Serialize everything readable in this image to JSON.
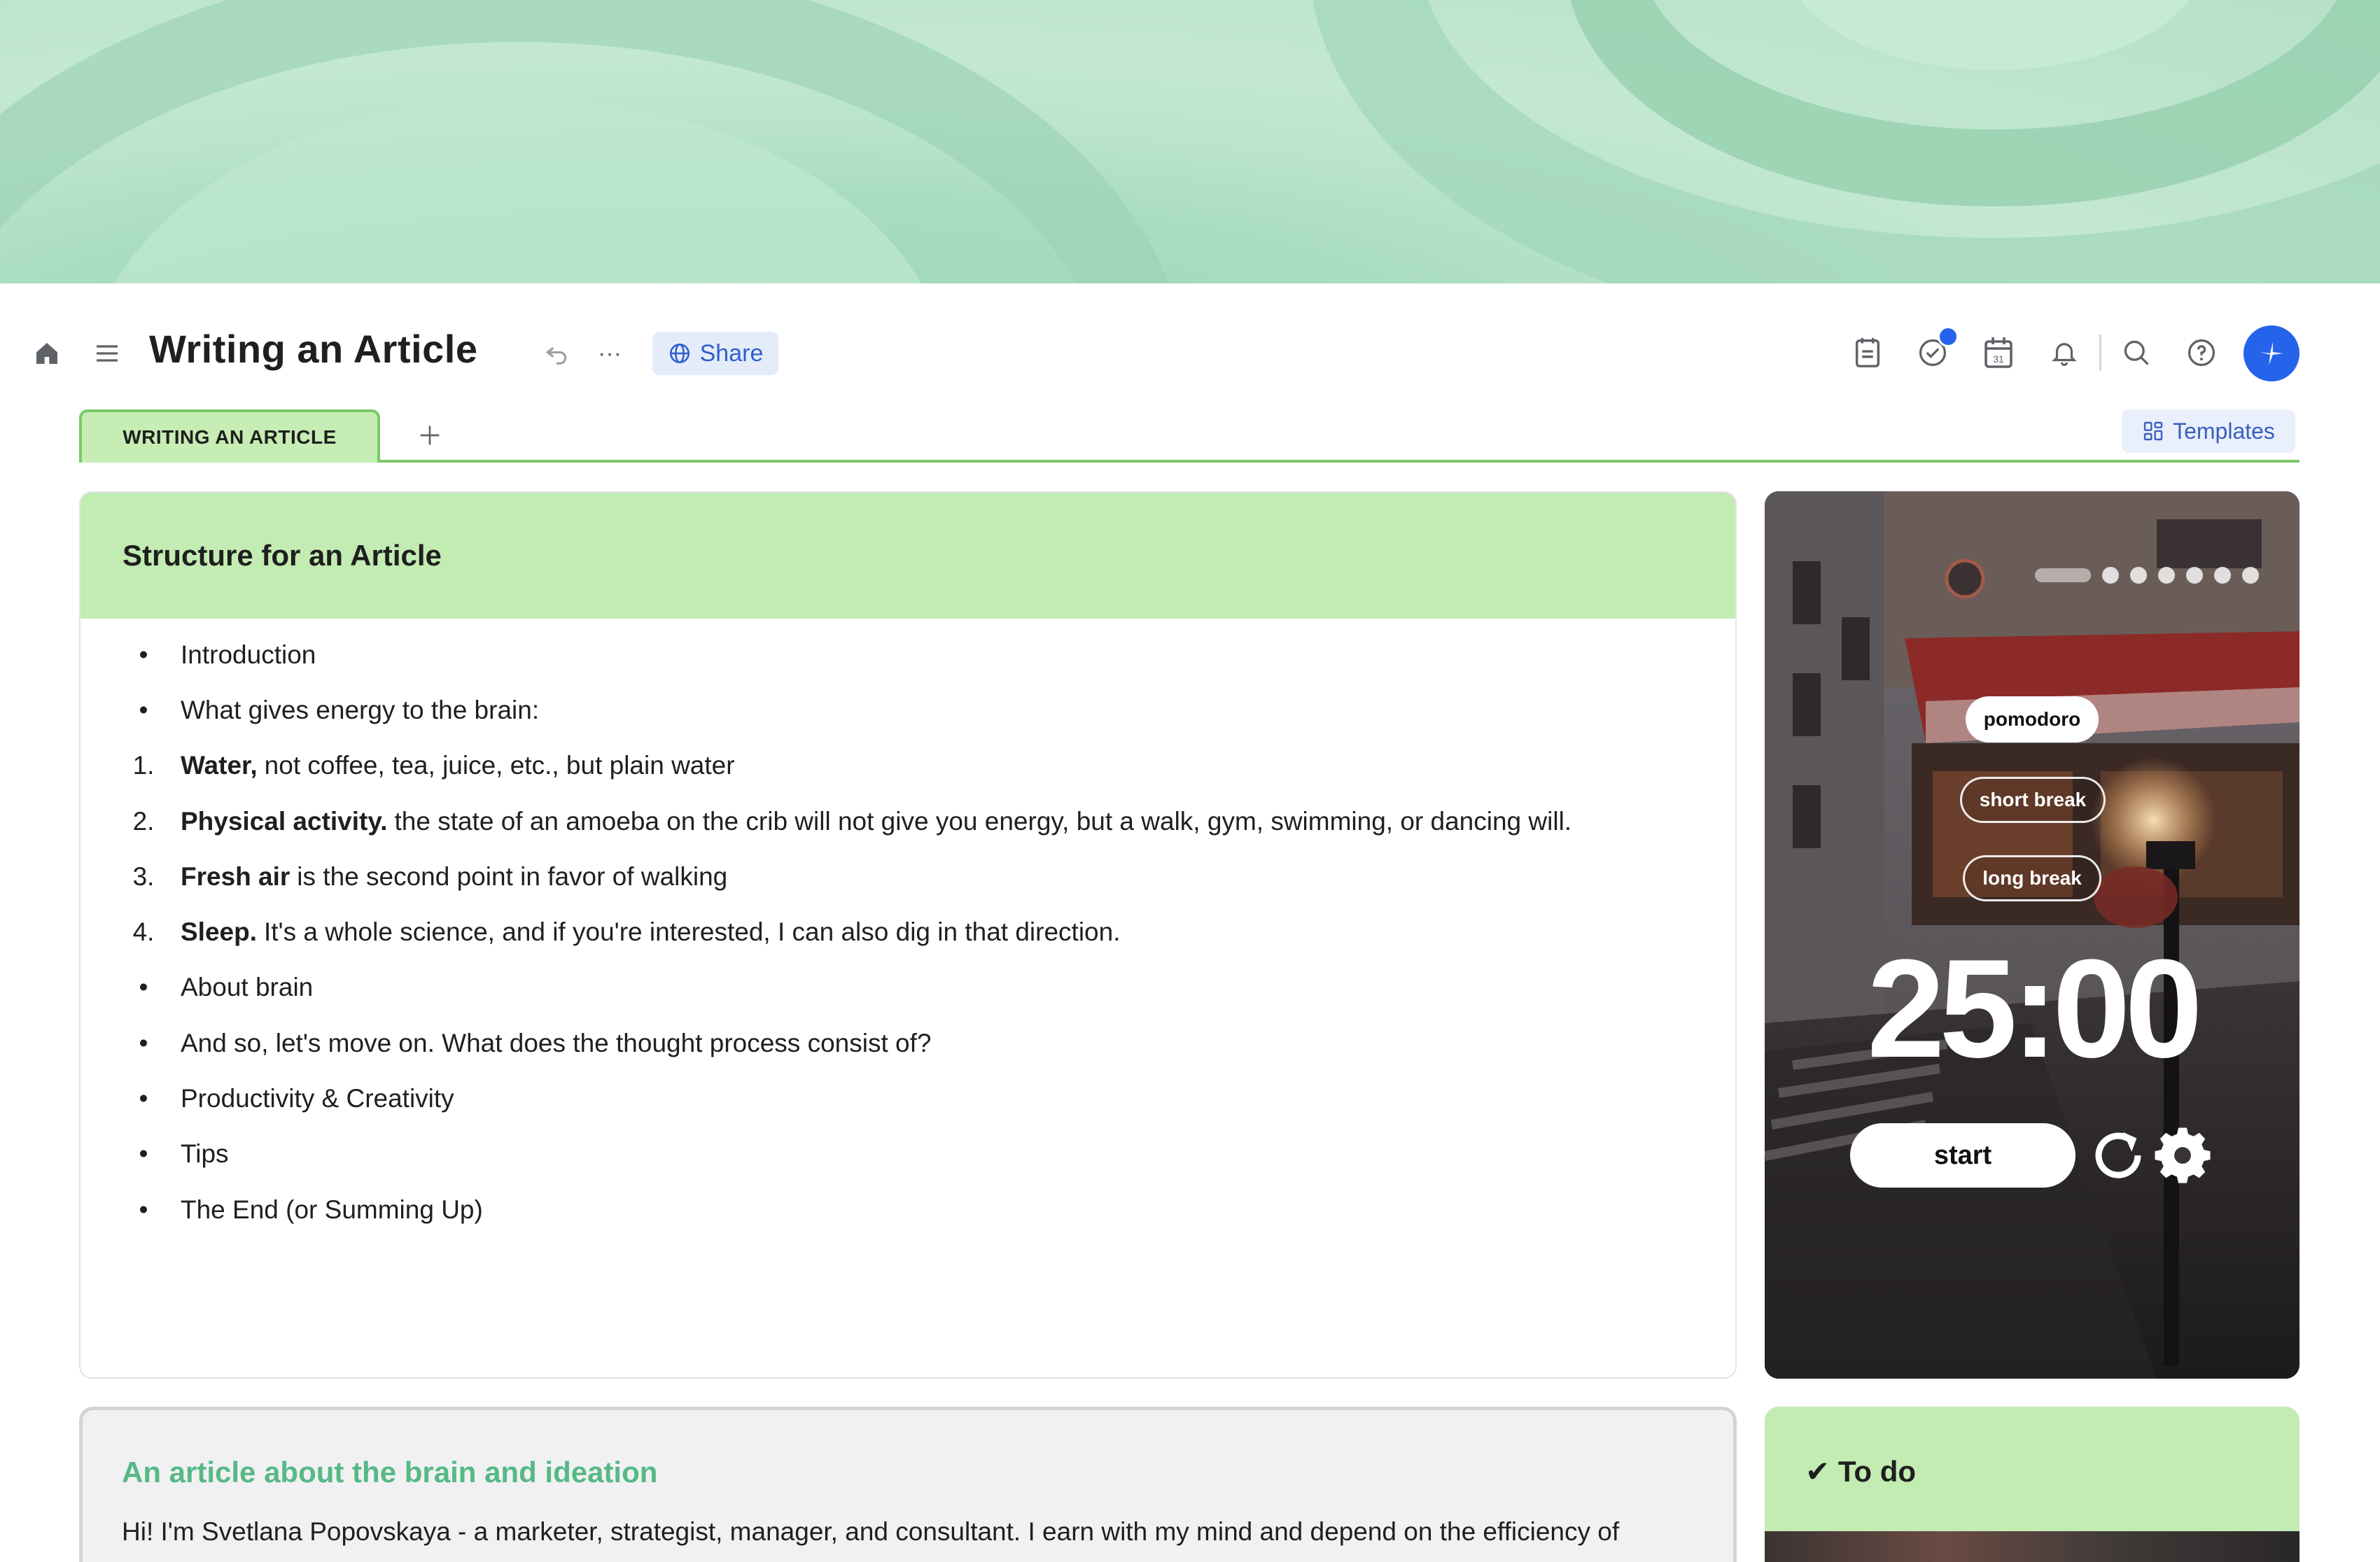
{
  "header": {
    "title": "Writing an Article",
    "share_label": "Share"
  },
  "tabs": [
    {
      "label": "WRITING AN ARTICLE",
      "active": true
    }
  ],
  "templates_label": "Templates",
  "structure_card": {
    "title": "Structure for an Article",
    "items": [
      {
        "marker": "•",
        "bold": "",
        "text": "Introduction"
      },
      {
        "marker": "•",
        "bold": "",
        "text": "What gives energy to the brain:"
      },
      {
        "marker": "1.",
        "bold": "Water,",
        "text": "not coffee, tea, juice, etc., but plain water"
      },
      {
        "marker": "2.",
        "bold": "Physical activity.",
        "text": "the state of an amoeba on the crib will not give you energy, but a walk, gym, swimming, or dancing will."
      },
      {
        "marker": "3.",
        "bold": "Fresh air",
        "text": "is the second point in favor of walking"
      },
      {
        "marker": "4.",
        "bold": "Sleep.",
        "text": "It's a whole science, and if you're interested, I can also dig in that direction."
      },
      {
        "marker": "•",
        "bold": "",
        "text": "About brain"
      },
      {
        "marker": "•",
        "bold": "",
        "text": "And so, let's move on. What does the thought process consist of?"
      },
      {
        "marker": "•",
        "bold": "",
        "text": "Productivity & Creativity"
      },
      {
        "marker": "•",
        "bold": "",
        "text": "Tips"
      },
      {
        "marker": "•",
        "bold": "",
        "text": "The End (or Summing Up)"
      }
    ]
  },
  "pomodoro": {
    "modes": [
      "pomodoro",
      "short break",
      "long break"
    ],
    "active_mode": "pomodoro",
    "time": "25:00",
    "start_label": "start"
  },
  "article_card": {
    "title": "An article about the brain and ideation",
    "text": "Hi! I'm Svetlana Popovskaya - a marketer, strategist, manager, and consultant. I earn with my mind and depend on the efficiency of"
  },
  "todo_card": {
    "title": "✔ To do"
  },
  "colors": {
    "accent_green": "#c3ecb2",
    "tab_border": "#7bc96a",
    "primary_blue": "#2563eb",
    "article_title_green": "#56b985"
  }
}
